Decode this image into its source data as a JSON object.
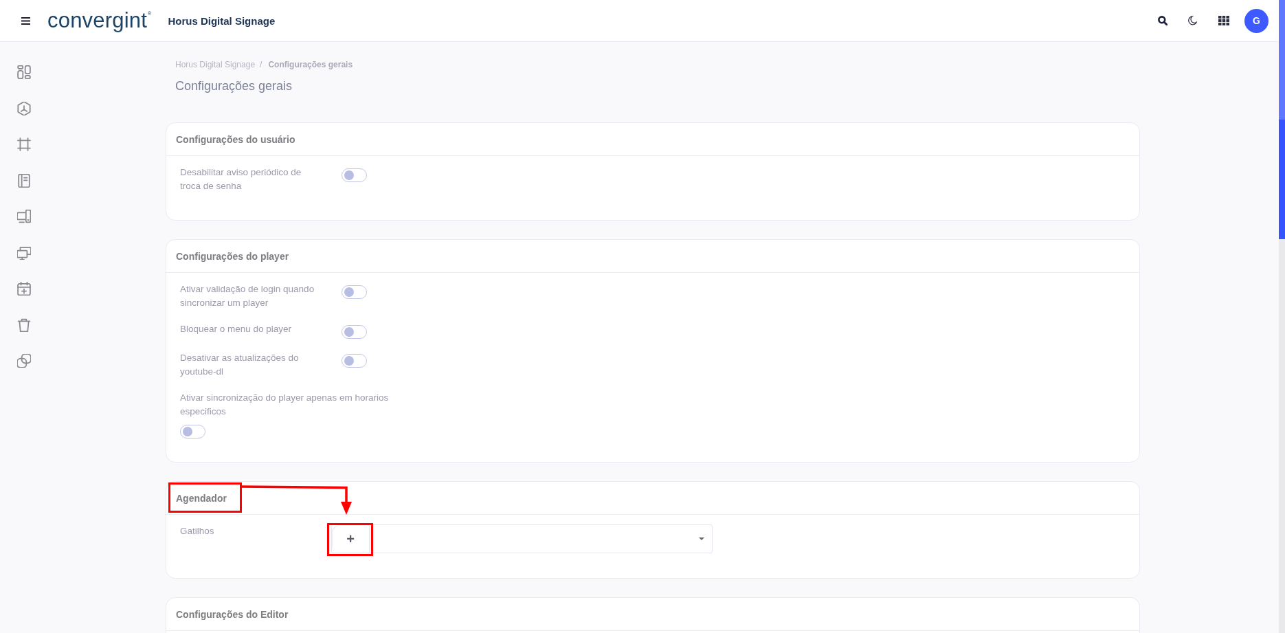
{
  "topbar": {
    "logo": "convergint$^{®}$",
    "title": "Horus Digital Signage",
    "avatar": "G"
  },
  "sidebar": {
    "items": [
      {
        "kind": "layout"
      },
      {
        "kind": "cube"
      },
      {
        "kind": "frame"
      },
      {
        "kind": "notebook"
      },
      {
        "kind": "devices"
      },
      {
        "kind": "monitors"
      },
      {
        "kind": "calendar"
      },
      {
        "kind": "trash"
      },
      {
        "kind": "copies"
      }
    ]
  },
  "breadcrumb": {
    "items": [
      {
        "label": "Horus Digital Signage",
        "current": false
      },
      {
        "label": "Configurações gerais",
        "current": true
      }
    ],
    "separator": "/"
  },
  "page_title": "Configurações gerais",
  "sections": [
    {
      "title": "Configurações do usuário",
      "highlighted": false,
      "settings": [
        {
          "kind": "toggle",
          "label": "Desabilitar aviso periódico de troca de senha",
          "on": false
        }
      ]
    },
    {
      "title": "Configurações do player",
      "highlighted": false,
      "settings": [
        {
          "kind": "toggle",
          "label": "Ativar validação de login quando sincronizar um player",
          "on": false
        },
        {
          "kind": "toggle",
          "label": "Bloquear o menu do player",
          "on": false
        },
        {
          "kind": "toggle",
          "label": "Desativar as atualizações do youtube-dl",
          "on": false
        },
        {
          "kind": "toggle-below",
          "label": "Ativar sincronização do player apenas em horarios especificos",
          "on": false
        }
      ]
    },
    {
      "title": "Agendador",
      "highlighted": true,
      "settings": [
        {
          "kind": "select",
          "label": "Gatilhos",
          "add_button": "+",
          "add_button_highlighted": true
        }
      ]
    },
    {
      "title": "Configurações do Editor",
      "highlighted": false
    }
  ]
}
